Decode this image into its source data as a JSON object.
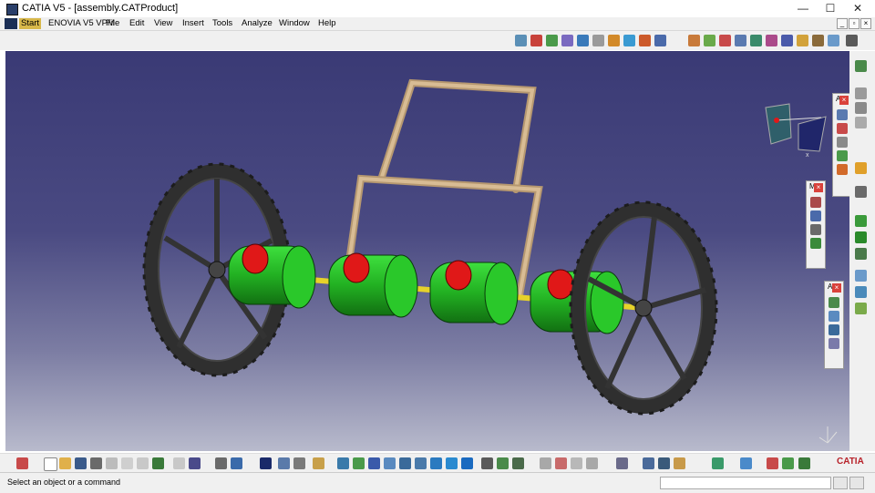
{
  "window": {
    "title": "CATIA V5 - [assembly.CATProduct]",
    "controls": {
      "minimize": "—",
      "maximize": "☐",
      "close": "✕"
    }
  },
  "menubar": {
    "items": [
      "Start",
      "ENOVIA V5 VPM",
      "File",
      "Edit",
      "View",
      "Insert",
      "Tools",
      "Analyze",
      "Window",
      "Help"
    ],
    "active_item": "Start",
    "mdi_controls": {
      "minimize": "_",
      "restore": "▫",
      "close": "×"
    }
  },
  "floating_toolbars": [
    {
      "label": "A",
      "close": "×"
    },
    {
      "label": "M",
      "close": "×"
    },
    {
      "label": "A",
      "close": "×"
    }
  ],
  "compass_axis_label": "x",
  "status_bar": {
    "message": "Select an object or a command"
  },
  "brand": {
    "name": "CATIA",
    "accent": "#d9423b"
  },
  "colors": {
    "hub_green": "#22b022",
    "hub_red": "#e01818",
    "frame_tan": "#c8aa82",
    "wheel_dark": "#2f2f2f",
    "axle_yellow": "#e6d22a",
    "viewport_top": "#3a3a75",
    "viewport_bottom": "#b8bacc"
  }
}
